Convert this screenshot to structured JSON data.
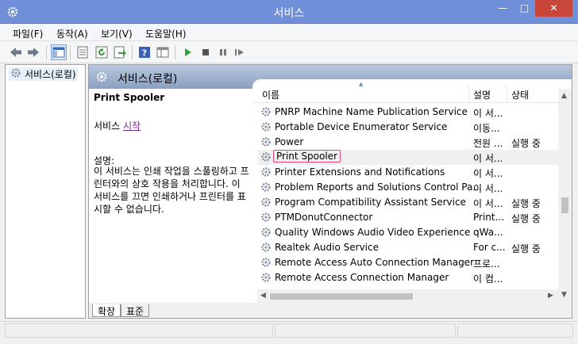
{
  "window": {
    "title": "서비스"
  },
  "menu": [
    "파일(F)",
    "동작(A)",
    "보기(V)",
    "도움말(H)"
  ],
  "icons": {
    "app": "services-gear-icon",
    "toolbar": [
      "back-arrow-icon",
      "forward-arrow-icon",
      "console-tree-icon",
      "properties-icon",
      "refresh-icon",
      "export-list-icon",
      "help-icon",
      "view-pane-icon",
      "start-icon",
      "stop-icon",
      "pause-icon",
      "restart-icon"
    ]
  },
  "tree": {
    "root_label": "서비스(로컬)"
  },
  "panel": {
    "header": "서비스(로컬)"
  },
  "detail": {
    "service_name": "Print Spooler",
    "action_prefix": "서비스 ",
    "action_link": "시작",
    "description_label": "설명:",
    "description_text": "이 서비스는 인쇄 작업을 스풀링하고 프린터와의 상호 작용을 처리합니다. 이 서비스를 끄면 인쇄하거나 프린터를 표시할 수 없습니다."
  },
  "columns": {
    "name": "이름",
    "description": "설명",
    "status": "상태"
  },
  "services": [
    {
      "name": "PNRP Machine Name Publication Service",
      "description": "이 서...",
      "status": ""
    },
    {
      "name": "Portable Device Enumerator Service",
      "description": "이동...",
      "status": ""
    },
    {
      "name": "Power",
      "description": "전원 ...",
      "status": "실행 중"
    },
    {
      "name": "Print Spooler",
      "description": "이 서...",
      "status": ""
    },
    {
      "name": "Printer Extensions and Notifications",
      "description": "이 서...",
      "status": ""
    },
    {
      "name": "Problem Reports and Solutions Control Pa...",
      "description": "이 서...",
      "status": ""
    },
    {
      "name": "Program Compatibility Assistant Service",
      "description": "이 서...",
      "status": "실행 중"
    },
    {
      "name": "PTMDonutConnector",
      "description": "Print...",
      "status": "실행 중"
    },
    {
      "name": "Quality Windows Audio Video Experience",
      "description": "qWa...",
      "status": ""
    },
    {
      "name": "Realtek Audio Service",
      "description": "For c...",
      "status": "실행 중"
    },
    {
      "name": "Remote Access Auto Connection Manager",
      "description": "프로...",
      "status": ""
    },
    {
      "name": "Remote Access Connection Manager",
      "description": "이 컴...",
      "status": ""
    }
  ],
  "selected_service": "Print Spooler",
  "tabs": [
    "확장",
    "표준"
  ],
  "colors": {
    "titlebar": "#6f8fd8",
    "highlight": "#e8457a",
    "link": "#7b2d99",
    "close": "#c9473a"
  }
}
